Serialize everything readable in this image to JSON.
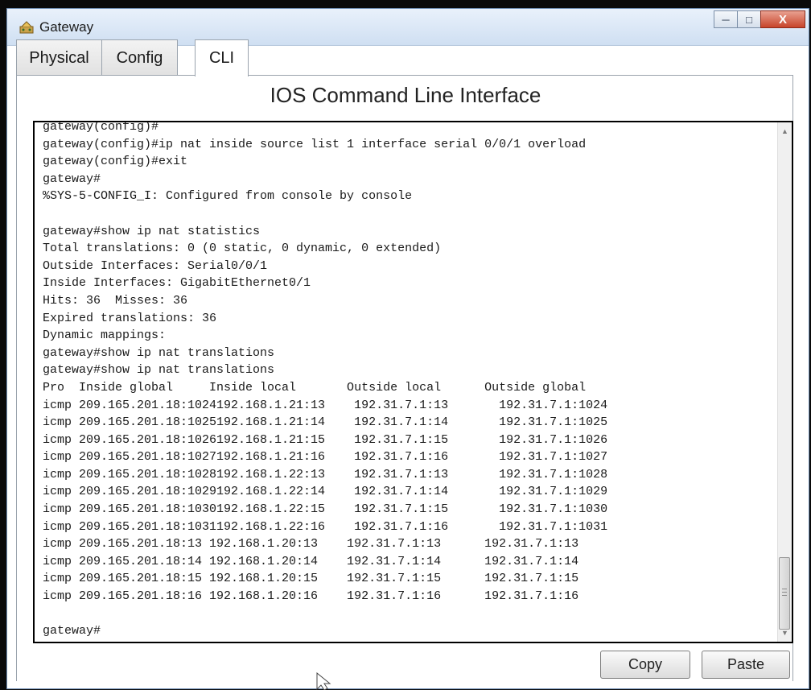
{
  "window": {
    "title": "Gateway",
    "icon": "gateway-app-icon",
    "controls": {
      "minimize": "─",
      "maximize": "□",
      "close": "X"
    }
  },
  "tabs": [
    {
      "label": "Physical",
      "active": false
    },
    {
      "label": "Config",
      "active": false
    },
    {
      "label": "CLI",
      "active": true
    }
  ],
  "cli": {
    "heading": "IOS Command Line Interface",
    "lines": [
      "gateway(config)#",
      "gateway(config)#ip nat inside source list 1 interface serial 0/0/1 overload",
      "gateway(config)#exit",
      "gateway#",
      "%SYS-5-CONFIG_I: Configured from console by console",
      "",
      "gateway#show ip nat statistics",
      "Total translations: 0 (0 static, 0 dynamic, 0 extended)",
      "Outside Interfaces: Serial0/0/1",
      "Inside Interfaces: GigabitEthernet0/1",
      "Hits: 36  Misses: 36",
      "Expired translations: 36",
      "Dynamic mappings:",
      "gateway#show ip nat translations",
      "gateway#show ip nat translations",
      "Pro  Inside global     Inside local       Outside local      Outside global",
      "icmp 209.165.201.18:1024192.168.1.21:13    192.31.7.1:13       192.31.7.1:1024",
      "icmp 209.165.201.18:1025192.168.1.21:14    192.31.7.1:14       192.31.7.1:1025",
      "icmp 209.165.201.18:1026192.168.1.21:15    192.31.7.1:15       192.31.7.1:1026",
      "icmp 209.165.201.18:1027192.168.1.21:16    192.31.7.1:16       192.31.7.1:1027",
      "icmp 209.165.201.18:1028192.168.1.22:13    192.31.7.1:13       192.31.7.1:1028",
      "icmp 209.165.201.18:1029192.168.1.22:14    192.31.7.1:14       192.31.7.1:1029",
      "icmp 209.165.201.18:1030192.168.1.22:15    192.31.7.1:15       192.31.7.1:1030",
      "icmp 209.165.201.18:1031192.168.1.22:16    192.31.7.1:16       192.31.7.1:1031",
      "icmp 209.165.201.18:13 192.168.1.20:13    192.31.7.1:13      192.31.7.1:13",
      "icmp 209.165.201.18:14 192.168.1.20:14    192.31.7.1:14      192.31.7.1:14",
      "icmp 209.165.201.18:15 192.168.1.20:15    192.31.7.1:15      192.31.7.1:15",
      "icmp 209.165.201.18:16 192.168.1.20:16    192.31.7.1:16      192.31.7.1:16",
      "",
      "gateway#"
    ]
  },
  "buttons": {
    "copy": "Copy",
    "paste": "Paste"
  },
  "colors": {
    "terminal_border": "#000000",
    "title_gradient_top": "#e9f1fb",
    "close_button": "#c7442a"
  }
}
